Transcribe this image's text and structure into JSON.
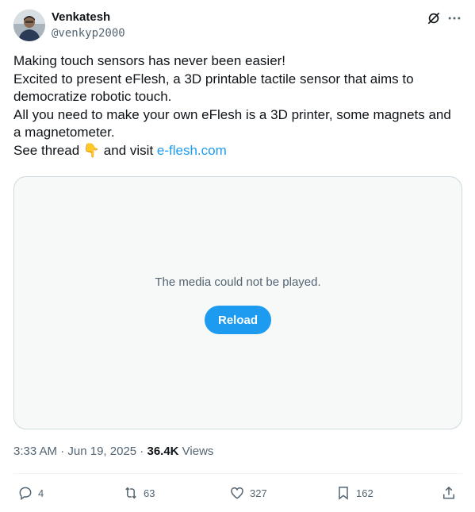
{
  "author": {
    "name": "Venkatesh",
    "handle": "@venkyp2000",
    "avatar_icon": "profile-photo"
  },
  "top_actions": {
    "grok_icon": "grok-slash-icon",
    "more_icon": "more-horizontal-icon"
  },
  "tweet": {
    "lines": [
      "Making touch sensors has never been easier!",
      "Excited to present eFlesh, a 3D printable tactile sensor that aims to",
      "democratize robotic touch.",
      "All you need to make your own eFlesh is a 3D printer, some magnets and",
      "a magnetometer."
    ],
    "last_line_prefix": "See thread ",
    "last_line_emoji": "👇",
    "last_line_middle": " and visit ",
    "link_text": "e-flesh.com"
  },
  "media": {
    "message": "The media could not be played.",
    "reload_label": "Reload"
  },
  "meta": {
    "time": "3:33 AM",
    "separator1": " · ",
    "date": "Jun 19, 2025",
    "separator2": " · ",
    "views_count": "36.4K",
    "views_label": " Views"
  },
  "actions": {
    "replies": "4",
    "reposts": "63",
    "likes": "327",
    "bookmarks": "162"
  },
  "colors": {
    "accent": "#1d9bf0",
    "text": "#0f1419",
    "muted": "#536471",
    "media_bg": "#f7f9f9",
    "border": "#cfd9de"
  }
}
